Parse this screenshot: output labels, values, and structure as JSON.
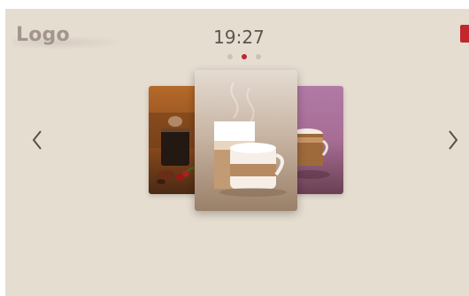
{
  "header": {
    "logo_text": "Logo",
    "time": "19:27"
  },
  "carousel": {
    "pages": 3,
    "active_page_index": 1,
    "prev_icon": "chevron-left-icon",
    "next_icon": "chevron-right-icon",
    "cards": [
      {
        "position": "left",
        "image": "espresso-with-coffee-beans"
      },
      {
        "position": "center",
        "image": "cappuccino-and-latte-macchiato"
      },
      {
        "position": "right",
        "image": "coffee-cup-pink-background"
      }
    ]
  },
  "colors": {
    "background": "#e6ddd1",
    "accent": "#c1272d",
    "logo": "#a3958e",
    "text": "#5c5550"
  }
}
